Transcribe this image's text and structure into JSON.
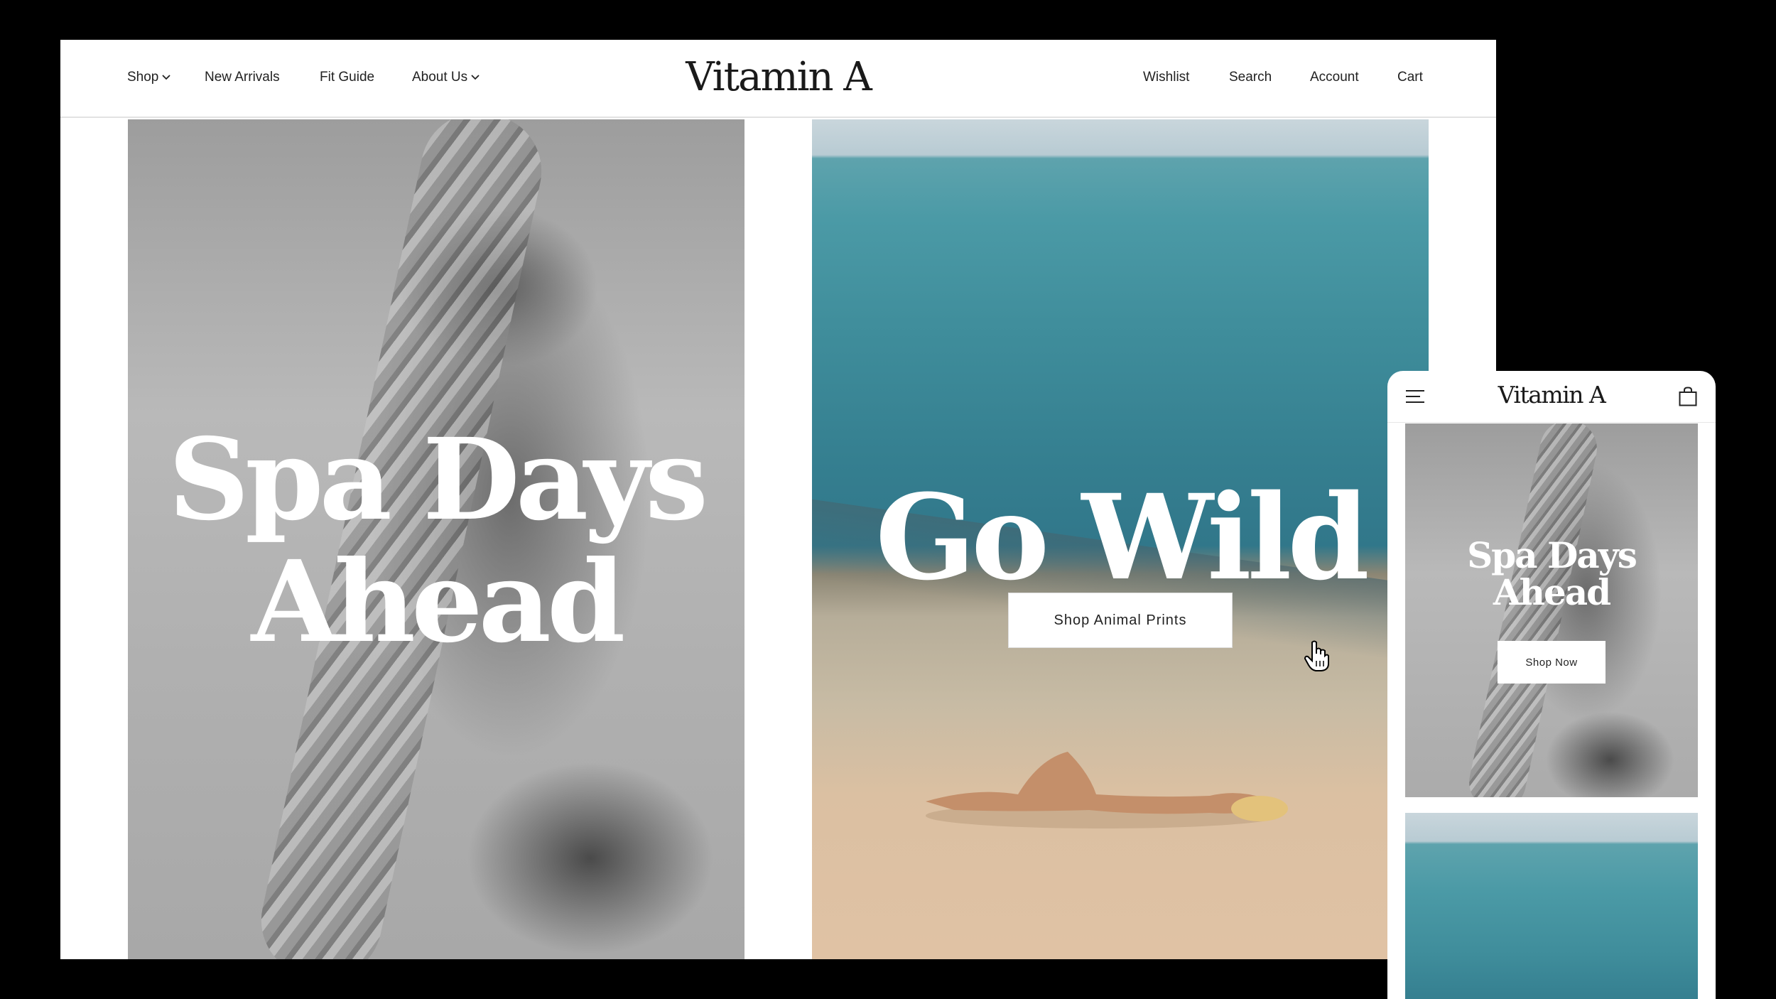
{
  "desktop": {
    "nav": {
      "left": [
        {
          "label": "Shop",
          "has_dropdown": true
        },
        {
          "label": "New Arrivals",
          "has_dropdown": false
        },
        {
          "label": "Fit Guide",
          "has_dropdown": false
        },
        {
          "label": "About Us",
          "has_dropdown": true
        }
      ],
      "logo": "Vitamin A",
      "right": [
        {
          "label": "Wishlist"
        },
        {
          "label": "Search"
        },
        {
          "label": "Account"
        },
        {
          "label": "Cart"
        }
      ]
    },
    "hero_left": {
      "title_line1": "Spa Days",
      "title_line2": "Ahead",
      "image": "black-and-white photo of woman with fringed scarf"
    },
    "hero_right": {
      "title": "Go Wild",
      "button_label": "Shop Animal Prints",
      "image": "woman sunbathing on beach by turquoise sea"
    },
    "cursor": "hand-pointer-icon"
  },
  "mobile": {
    "menu_icon": "hamburger-icon",
    "logo": "Vitamin A",
    "bag_icon": "shopping-bag-icon",
    "hero": {
      "title_line1": "Spa Days",
      "title_line2": "Ahead",
      "button_label": "Shop Now"
    }
  },
  "colors": {
    "page_background": "#000000",
    "window_background": "#ffffff",
    "text": "#222222",
    "hero_text": "#ffffff"
  }
}
